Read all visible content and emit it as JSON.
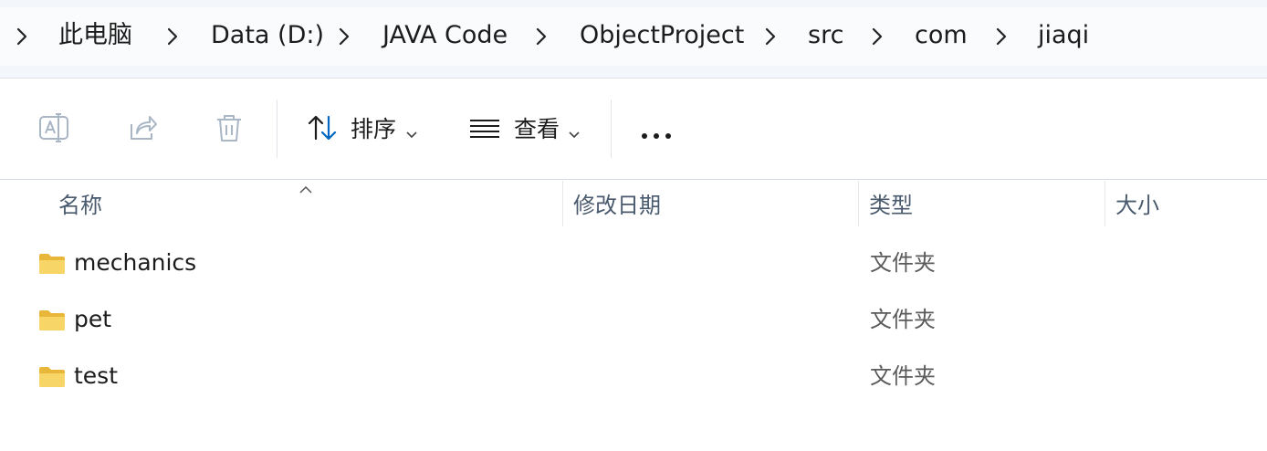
{
  "breadcrumb": {
    "items": [
      {
        "label": "此电脑"
      },
      {
        "label": "Data (D:)"
      },
      {
        "label": "JAVA Code"
      },
      {
        "label": "ObjectProject"
      },
      {
        "label": "src"
      },
      {
        "label": "com"
      },
      {
        "label": "jiaqi"
      }
    ]
  },
  "toolbar": {
    "rename_icon": "rename-icon",
    "share_icon": "share-icon",
    "delete_icon": "trash-icon",
    "sort_label": "排序",
    "sort_icon": "sort-arrows-icon",
    "view_label": "查看",
    "view_icon": "list-lines-icon",
    "more_icon": "ellipsis-icon"
  },
  "columns": {
    "name": "名称",
    "modified": "修改日期",
    "type": "类型",
    "size": "大小"
  },
  "files": [
    {
      "name": "mechanics",
      "type": "文件夹",
      "icon": "folder-icon"
    },
    {
      "name": "pet",
      "type": "文件夹",
      "icon": "folder-icon"
    },
    {
      "name": "test",
      "type": "文件夹",
      "icon": "folder-icon"
    }
  ],
  "colors": {
    "folder": "#f2c94c",
    "accent": "#0067c0"
  }
}
